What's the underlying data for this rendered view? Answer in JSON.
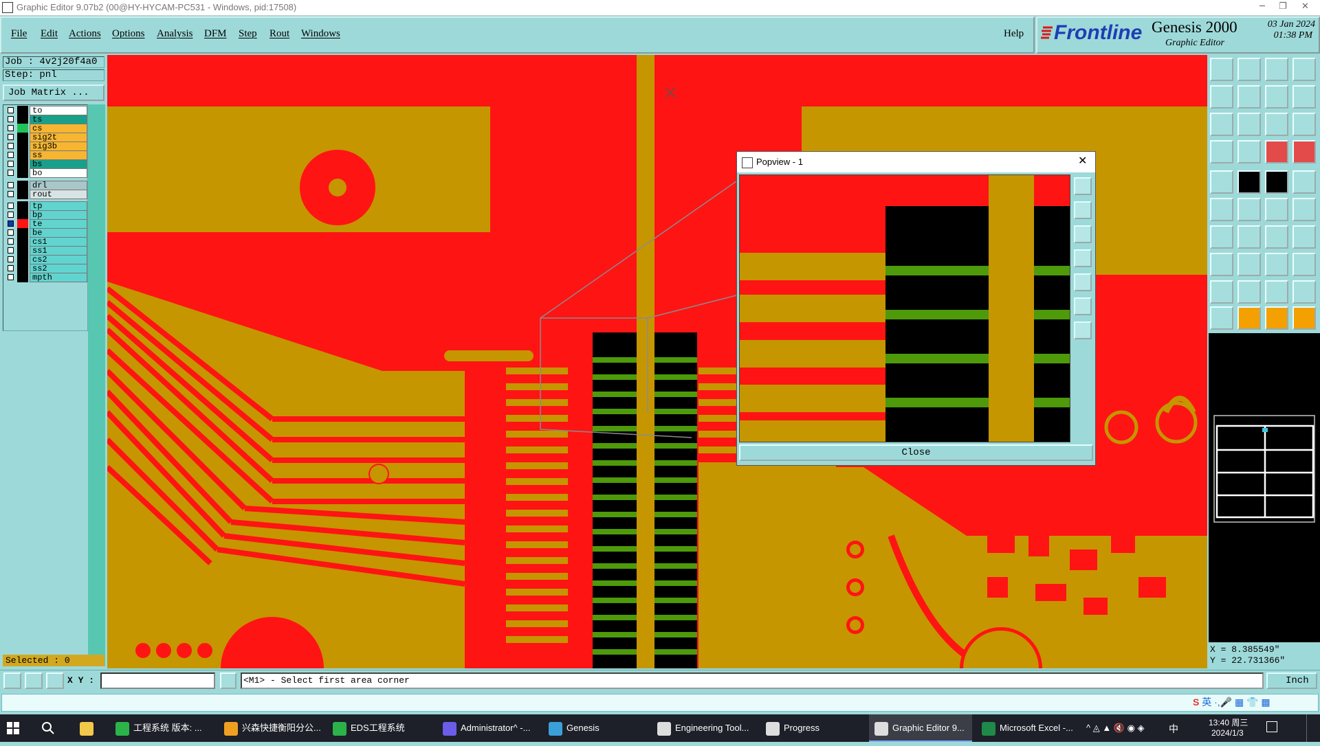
{
  "window": {
    "title": "Graphic Editor 9.07b2 (00@HY-HYCAM-PC531 - Windows, pid:17508)"
  },
  "menu": {
    "items": [
      "File",
      "Edit",
      "Actions",
      "Options",
      "Analysis",
      "DFM",
      "Step",
      "Rout",
      "Windows"
    ],
    "help": "Help"
  },
  "branding": {
    "logo_text": "Frontline",
    "product": "Genesis 2000",
    "subtitle": "Graphic Editor",
    "date": "03 Jan 2024",
    "time": "01:38 PM"
  },
  "job": {
    "job_label": "Job : 4v2j20f4a0",
    "step_label": "Step: pnl",
    "matrix_button": "Job Matrix ..."
  },
  "layers": [
    {
      "name": "to",
      "color": "#ffffff",
      "swatch": "#000000",
      "checked": false
    },
    {
      "name": "ts",
      "color": "#18a08a",
      "swatch": "#000000",
      "checked": false
    },
    {
      "name": "cs",
      "color": "#f6b631",
      "swatch": "#22c25b",
      "checked": false
    },
    {
      "name": "sig2t",
      "color": "#f6b631",
      "swatch": "#000000",
      "checked": false
    },
    {
      "name": "sig3b",
      "color": "#f6b631",
      "swatch": "#000000",
      "checked": false
    },
    {
      "name": "ss",
      "color": "#f6b631",
      "swatch": "#000000",
      "checked": false
    },
    {
      "name": "bs",
      "color": "#18a08a",
      "swatch": "#000000",
      "checked": false
    },
    {
      "name": "bo",
      "color": "#ffffff",
      "swatch": "#000000",
      "checked": false
    },
    {
      "name": "drl",
      "color": "#a9c6c9",
      "swatch": "#000000",
      "checked": false
    },
    {
      "name": "rout",
      "color": "#d8e3e3",
      "swatch": "#000000",
      "checked": false
    },
    {
      "name": "tp",
      "color": "#61d4cf",
      "swatch": "#000000",
      "checked": false
    },
    {
      "name": "bp",
      "color": "#61d4cf",
      "swatch": "#000000",
      "checked": false
    },
    {
      "name": "te",
      "color": "#61d4cf",
      "swatch": "#ff1414",
      "checked": true
    },
    {
      "name": "be",
      "color": "#61d4cf",
      "swatch": "#000000",
      "checked": false
    },
    {
      "name": "cs1",
      "color": "#61d4cf",
      "swatch": "#000000",
      "checked": false
    },
    {
      "name": "ss1",
      "color": "#61d4cf",
      "swatch": "#000000",
      "checked": false
    },
    {
      "name": "cs2",
      "color": "#61d4cf",
      "swatch": "#000000",
      "checked": false
    },
    {
      "name": "ss2",
      "color": "#61d4cf",
      "swatch": "#000000",
      "checked": false
    },
    {
      "name": "mpth",
      "color": "#61d4cf",
      "swatch": "#000000",
      "checked": false
    }
  ],
  "status": {
    "selected": "Selected : 0",
    "xy_label": "X Y :",
    "prompt": "<M1> - Select first area corner",
    "units": "Inch",
    "x_readout": "X = 8.385549\"",
    "y_readout": "Y = 22.731366\""
  },
  "popview": {
    "title": "Popview - 1",
    "close_label": "Close"
  },
  "colors": {
    "board_red": "#ff1414",
    "copper_gold": "#c59600",
    "pad_green": "#4e9a0a",
    "background_teal": "#9ed9d9"
  },
  "taskbar": {
    "items": [
      {
        "label": "工程系统    版本: ...",
        "icon": "#2bb34a"
      },
      {
        "label": "兴森快捷衡阳分公...",
        "icon": "#f0a020"
      },
      {
        "label": "EDS工程系统",
        "icon": "#2bb34a"
      },
      {
        "label": "Administrator^ -...",
        "icon": "#6b5de8"
      },
      {
        "label": "Genesis",
        "icon": "#3aa0d8"
      },
      {
        "label": "Engineering Tool...",
        "icon": "#dddddd"
      },
      {
        "label": "Progress",
        "icon": "#dddddd"
      },
      {
        "label": "Graphic Editor 9...",
        "icon": "#dddddd"
      },
      {
        "label": "Microsoft Excel -...",
        "icon": "#1f8a48"
      }
    ],
    "clock_time": "13:40 周三",
    "clock_date": "2024/1/3",
    "ime": "中",
    "ime2": "英"
  }
}
